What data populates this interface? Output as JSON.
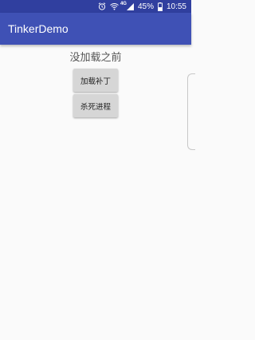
{
  "status_bar": {
    "network_label": "4G",
    "battery_percent": "45%",
    "time": "10:55",
    "battery_level": 0.45
  },
  "app_bar": {
    "title": "TinkerDemo"
  },
  "main": {
    "status_text": "没加载之前",
    "load_patch_button": "加载补丁",
    "kill_process_button": "杀死进程"
  },
  "colors": {
    "status_bar": "#303f9f",
    "app_bar": "#3f51b5",
    "background": "#fafafa",
    "button": "#d6d6d6"
  }
}
